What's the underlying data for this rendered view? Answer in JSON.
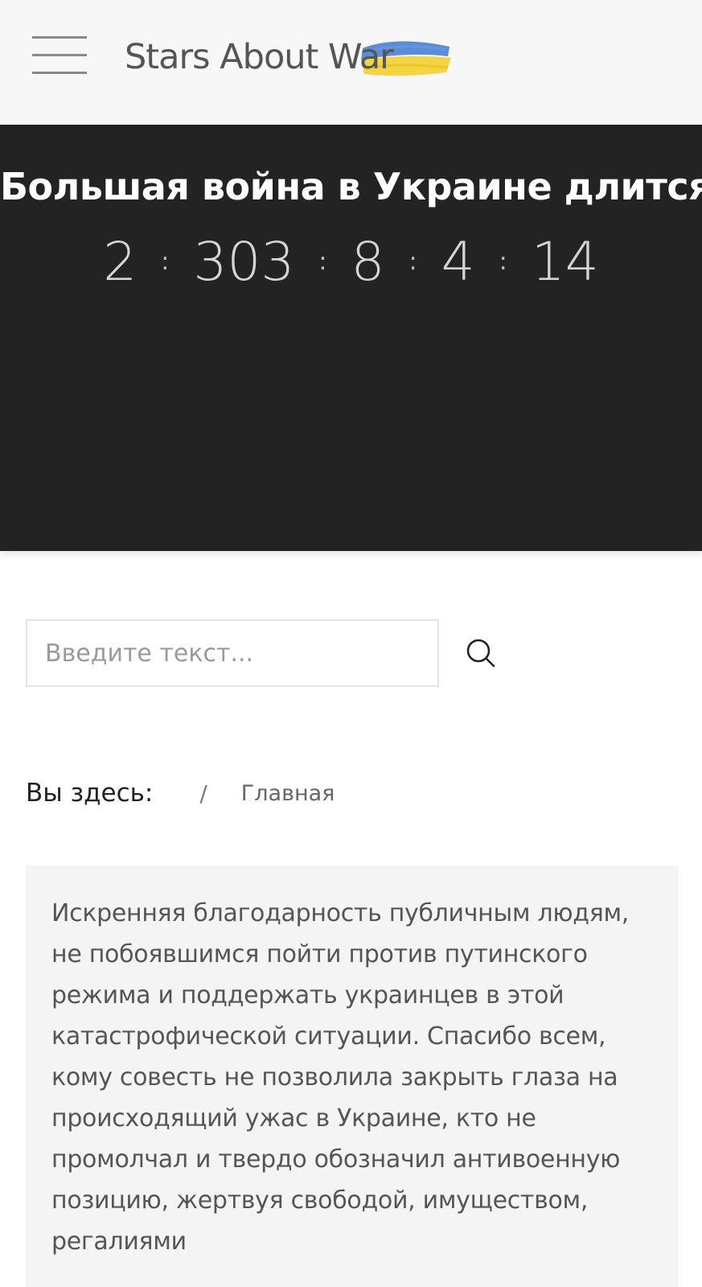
{
  "header": {
    "logo_text": "Stars About War",
    "menu_icon": "hamburger-menu-icon",
    "flag_colors": {
      "blue": "#4a7fd0",
      "yellow": "#f2d23a"
    }
  },
  "hero": {
    "title": "Большая война в Украине длится",
    "countdown": {
      "years": "2",
      "days": "303",
      "hours": "8",
      "minutes": "4",
      "seconds": "14",
      "separator": ":"
    }
  },
  "search": {
    "placeholder": "Введите текст...",
    "value": "",
    "button_icon": "search-icon"
  },
  "breadcrumb": {
    "label": "Вы здесь:",
    "separator": "/",
    "home": "Главная"
  },
  "quote": {
    "text": "Искренняя благодарность публичным людям, не побоявшимся пойти против путинского режима и поддержать украинцев в этой катастрофической ситуации. Спасибо всем, кому совесть не позволила закрыть глаза на происходящий ужас в Украине, кто не промолчал и твердо обозначил антивоенную позицию, жертвуя свободой, имуществом, регалиями"
  },
  "colors": {
    "header_bg": "#f7f7f7",
    "hero_bg": "#232323",
    "quote_bg": "#f4f4f4"
  }
}
